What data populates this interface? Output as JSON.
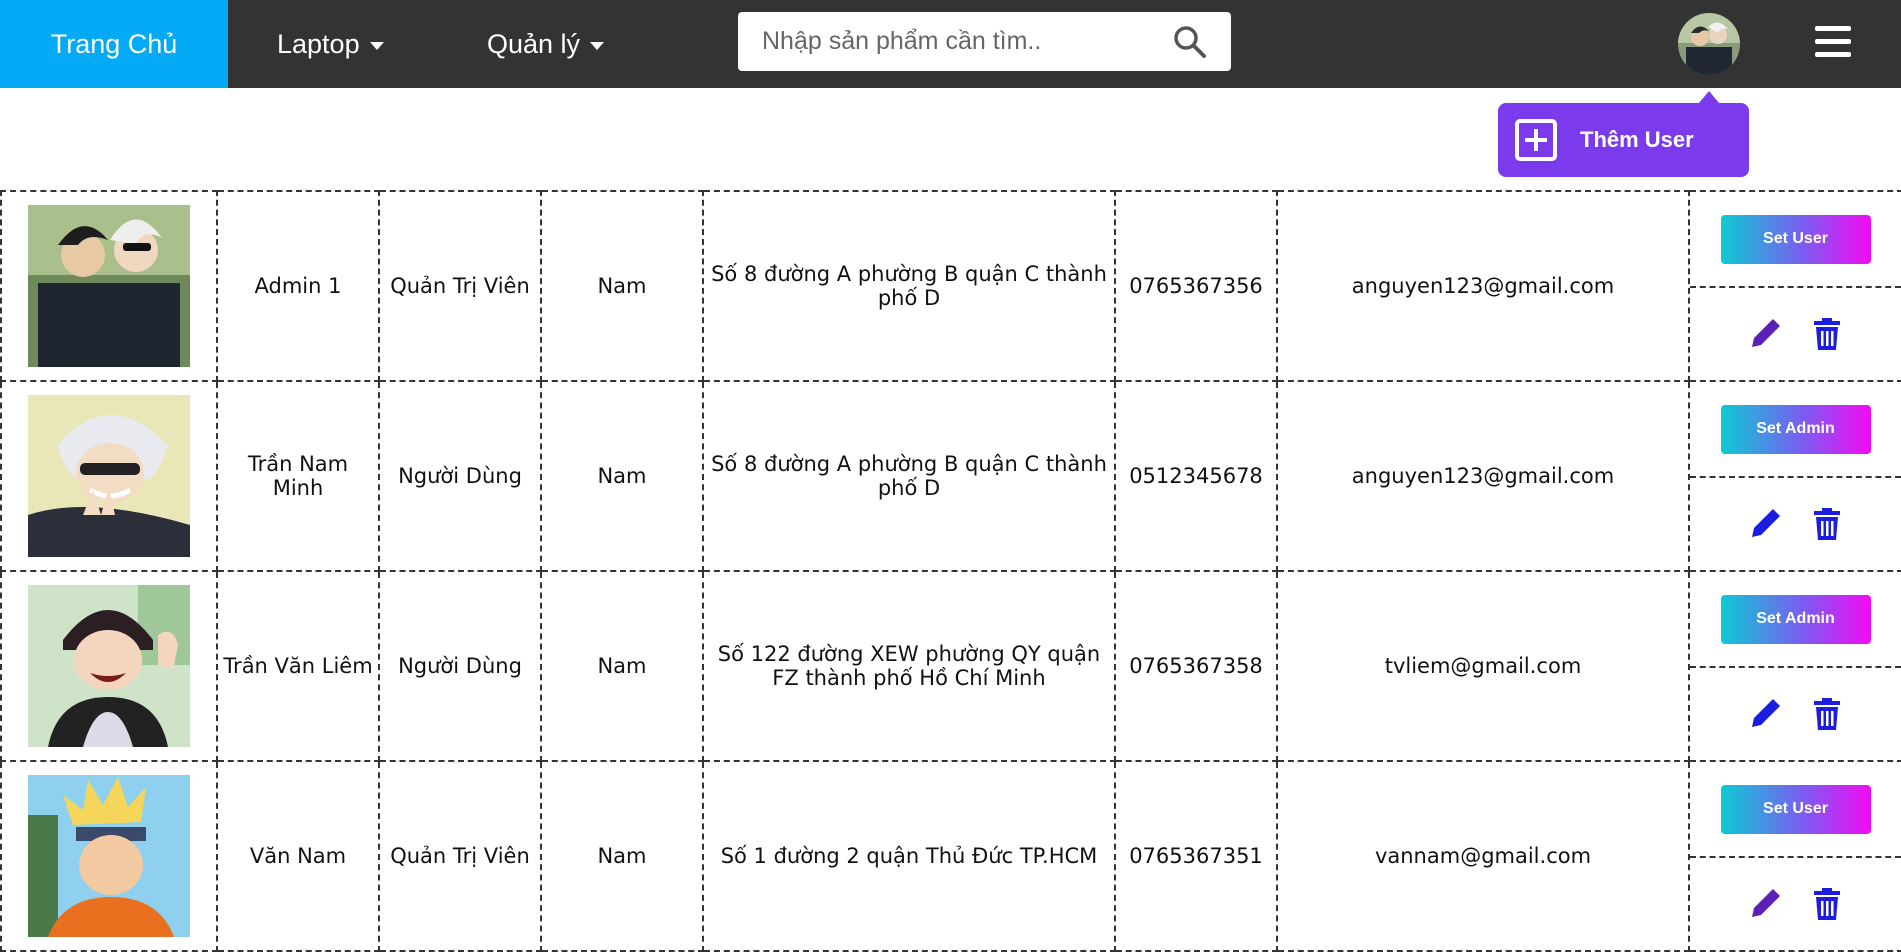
{
  "nav": {
    "home_label": "Trang Chủ",
    "laptop_label": "Laptop",
    "manage_label": "Quản lý"
  },
  "search": {
    "placeholder": "Nhập sản phẩm cần tìm..",
    "value": ""
  },
  "add_user": {
    "label": "Thêm User"
  },
  "colors": {
    "nav_bg": "#333333",
    "home_bg": "#04aaf6",
    "add_user_bg": "#7c3aed",
    "edit_icon": "#5b21b6",
    "trash_icon": "#1d1de0"
  },
  "icons": {
    "search": "search-icon",
    "menu": "hamburger-menu-icon",
    "add": "plus-square-icon",
    "edit": "pencil-icon",
    "delete": "trash-icon"
  },
  "users": [
    {
      "name": "Admin 1",
      "role": "Quản Trị Viên",
      "gender": "Nam",
      "address": "Số 8 đường A phường B quận C thành phố D",
      "phone": "0765367356",
      "email": "anguyen123@gmail.com",
      "action_label": "Set User"
    },
    {
      "name": "Trần Nam Minh",
      "role": "Người Dùng",
      "gender": "Nam",
      "address": "Số 8 đường A phường B quận C thành phố D",
      "phone": "0512345678",
      "email": "anguyen123@gmail.com",
      "action_label": "Set Admin"
    },
    {
      "name": "Trần Văn Liêm",
      "role": "Người Dùng",
      "gender": "Nam",
      "address": "Số 122 đường XEW phường QY quận FZ thành phố Hồ Chí Minh",
      "phone": "0765367358",
      "email": "tvliem@gmail.com",
      "action_label": "Set Admin"
    },
    {
      "name": "Văn Nam",
      "role": "Quản Trị Viên",
      "gender": "Nam",
      "address": "Số 1 đường 2 quận Thủ Đức TP.HCM",
      "phone": "0765367351",
      "email": "vannam@gmail.com",
      "action_label": "Set User"
    }
  ]
}
